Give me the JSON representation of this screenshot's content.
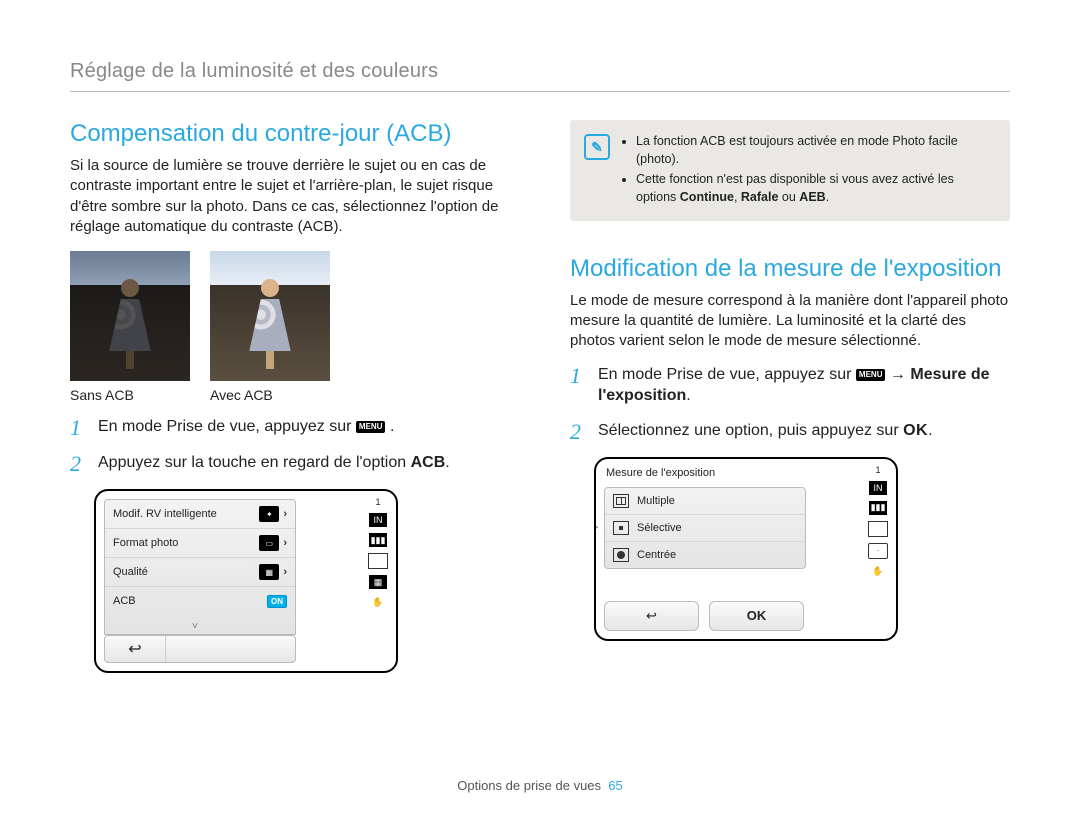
{
  "header": {
    "title": "Réglage de la luminosité et des couleurs"
  },
  "left": {
    "heading": "Compensation du contre-jour (ACB)",
    "intro": "Si la source de lumière se trouve derrière le sujet ou en cas de contraste important entre le sujet et l'arrière-plan, le sujet risque d'être sombre sur la photo. Dans ce cas, sélectionnez l'option de réglage automatique du contraste (ACB).",
    "photos": {
      "without": "Sans ACB",
      "with": "Avec ACB"
    },
    "steps": {
      "s1_pre": "En mode Prise de vue, appuyez sur ",
      "s1_post": ".",
      "s2_pre": "Appuyez sur la touche en regard de l'option ",
      "s2_bold": "ACB",
      "s2_post": "."
    }
  },
  "screen": {
    "menu": {
      "row1": "Modif. RV intelligente",
      "row2": "Format photo",
      "row3": "Qualité",
      "row4": "ACB",
      "on": "ON"
    },
    "topright_count": "1"
  },
  "right": {
    "callout": {
      "l1": "La fonction ACB est toujours activée en mode Photo facile (photo).",
      "l2_pre": "Cette fonction n'est pas disponible si vous avez activé les options ",
      "l2_bold1": "Continue",
      "l2_sep1": ", ",
      "l2_bold2": "Rafale",
      "l2_sep2": " ou ",
      "l2_bold3": "AEB",
      "l2_post": "."
    },
    "heading": "Modification de la mesure de l'exposition",
    "intro": "Le mode de mesure correspond à la manière dont l'appareil photo mesure la quantité de lumière. La luminosité et la clarté des photos varient selon le mode de mesure sélectionné.",
    "steps": {
      "s1_pre": "En mode Prise de vue, appuyez sur ",
      "s1_arrow": " → ",
      "s1_bold": "Mesure de l'exposition",
      "s1_post": ".",
      "s2_pre": "Sélectionnez une option, puis appuyez sur ",
      "s2_post": "."
    }
  },
  "screen2": {
    "title": "Mesure de l'exposition",
    "opt1": "Multiple",
    "opt2": "Sélective",
    "opt3": "Centrée",
    "ok": "OK",
    "topright_count": "1"
  },
  "menu_chip": "MENU",
  "ok_label": "OK",
  "footer": {
    "text": "Options de prise de vues",
    "page": "65"
  }
}
